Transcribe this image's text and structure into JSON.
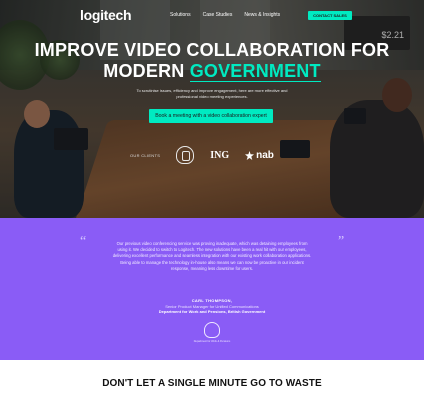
{
  "nav": {
    "logo": "logitech",
    "links": [
      "Solutions",
      "Case Studies",
      "News & Insights"
    ],
    "contact_label": "CONTACT SALES"
  },
  "hero": {
    "title_line1": "IMPROVE VIDEO COLLABORATION FOR",
    "title_line2_prefix": "MODERN ",
    "title_line2_accent": "GOVERNMENT",
    "subtitle": "To scrutinise issues, efficiency and improve engagement, here are more effective and professional video meeting experiences.",
    "cta_label": "Book a meeting with a video collaboration expert",
    "clients_label": "OUR CLIENTS",
    "client_ing": "ING",
    "client_nab": "nab",
    "screen_value": "$2.21"
  },
  "testimonial": {
    "quote": "Our previous video conferencing service was proving inadequate, which was detaining employees from using it. We decided to switch to Logitech. The new solutions have been a real hit with our employees, delivering excellent performance and seamless integration with our existing work collaboration applications. Being able to manage the technology in-house also means we can now be proactive in our incident response, meaning less downtime for users.",
    "author_name": "CARL THOMPSON,",
    "author_role": "Senior Product Manager for Unified Communications",
    "author_dept": "Department for Work and Pensions, British Government",
    "crest_caption": "Department for Work & Pensions",
    "open_quote": "“",
    "close_quote": "”"
  },
  "bottom": {
    "title": "DON'T LET A SINGLE MINUTE GO TO WASTE"
  },
  "colors": {
    "accent": "#00eac1",
    "testimonial_bg": "#8a5cf6"
  }
}
